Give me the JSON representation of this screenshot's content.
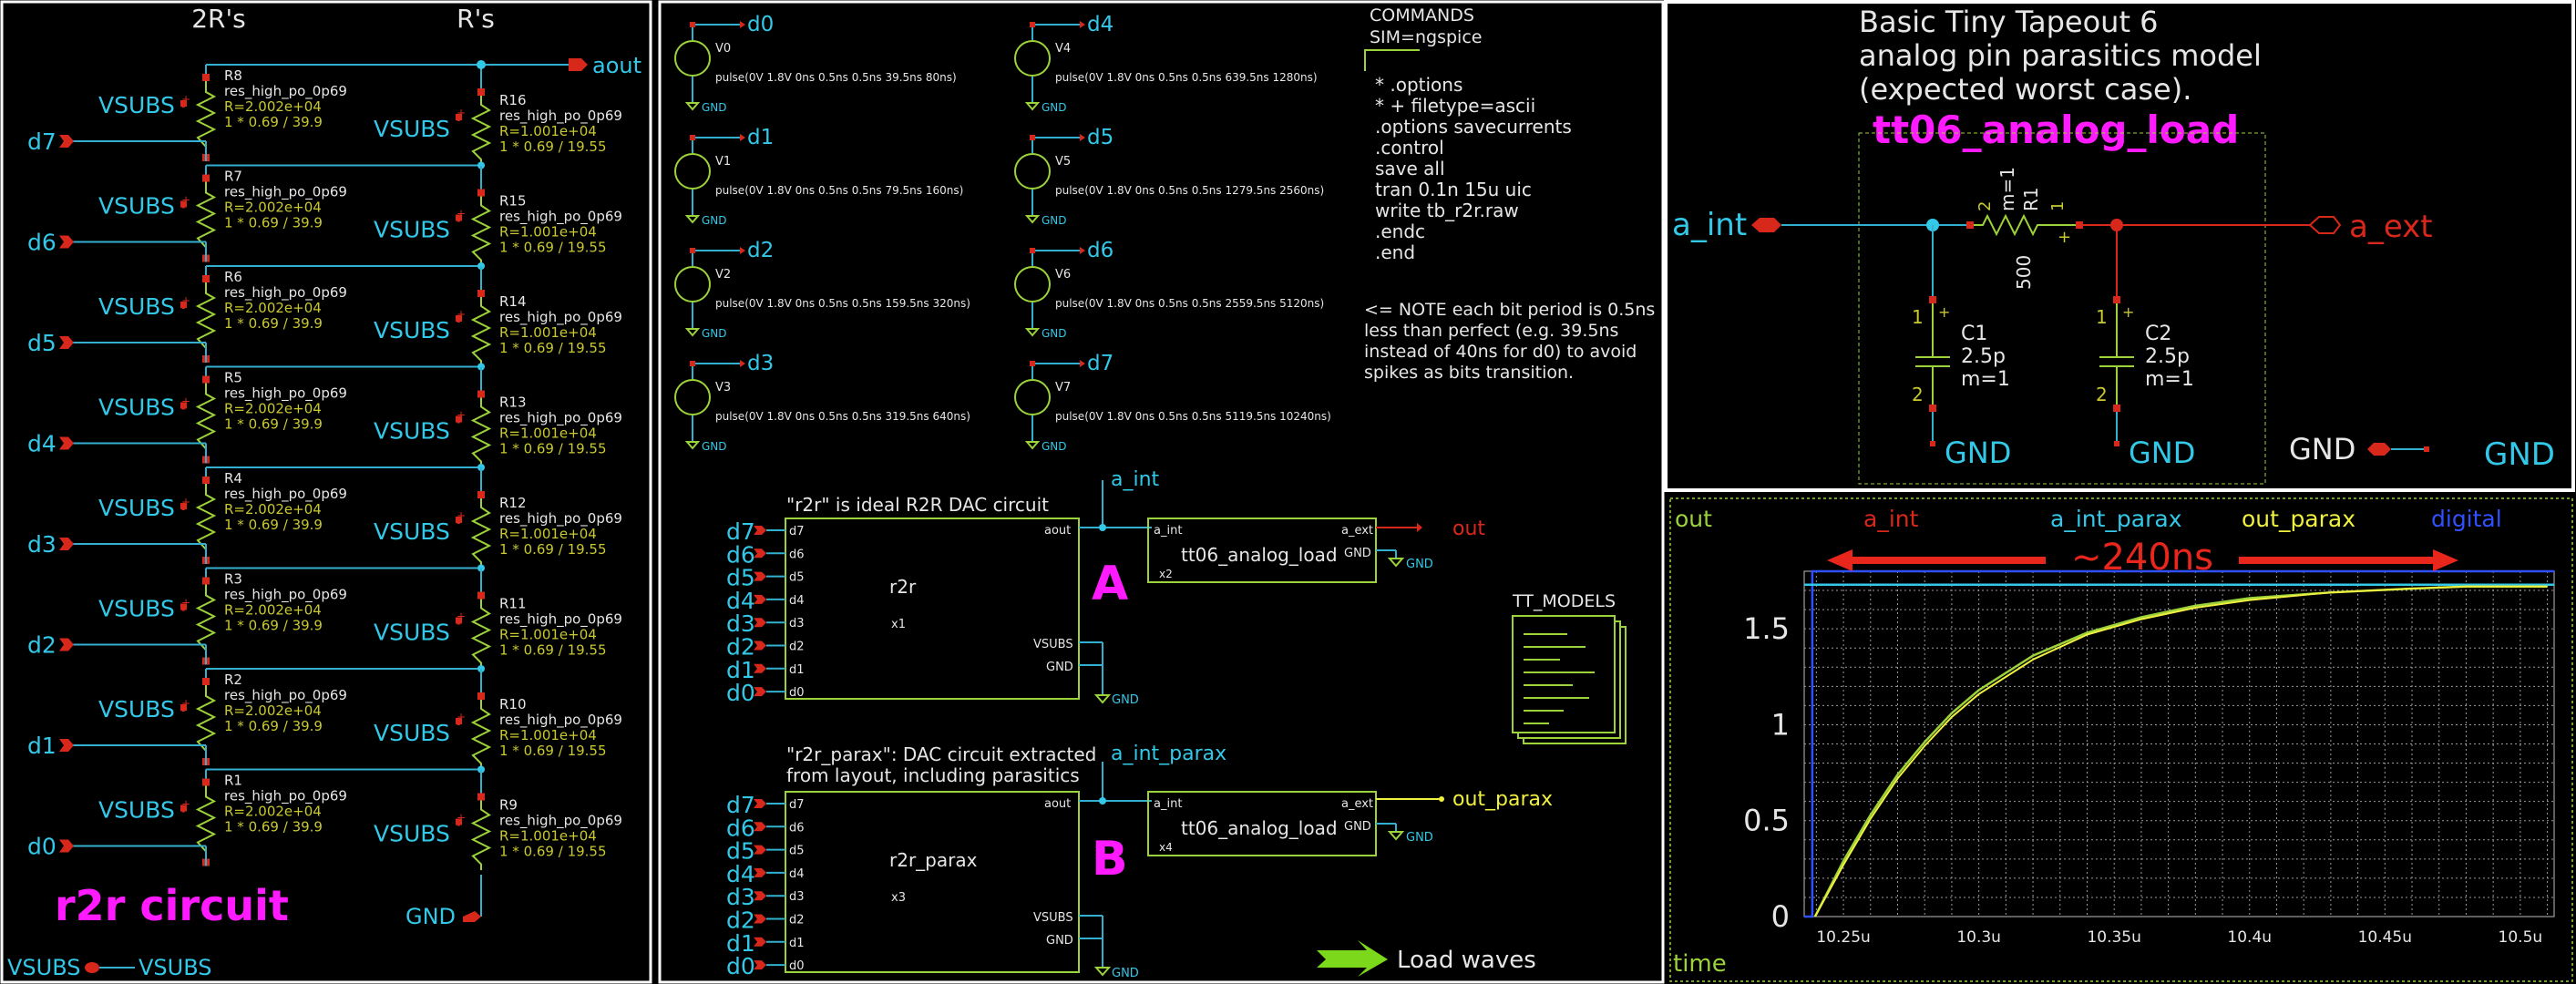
{
  "colors": {
    "background": "#000000",
    "wire": "#33b0d0",
    "label": "#33c8e8",
    "component": "#9cd23a",
    "pin": "#d8271b",
    "param": "#c8c830",
    "text": "#e6e6e6",
    "highlight": "#ff1aff",
    "panel_border": "#ffffff",
    "trace_yellow": "#f0f040",
    "trace_blue": "#3050ff",
    "trace_green": "#9cd23a"
  },
  "panel1": {
    "header_2r": "2R's",
    "header_r": "R's",
    "aout": "aout",
    "vsubs": "VSUBS",
    "gnd": "GND",
    "title": "r2r circuit",
    "footer_vsubs_a": "VSUBS",
    "footer_vsubs_b": "VSUBS",
    "pin_plus": "+",
    "pin_minus": "-",
    "rows": [
      {
        "digit": "d7",
        "r2": "R8",
        "r": "R16"
      },
      {
        "digit": "d6",
        "r2": "R7",
        "r": "R15"
      },
      {
        "digit": "d5",
        "r2": "R6",
        "r": "R14"
      },
      {
        "digit": "d4",
        "r2": "R5",
        "r": "R13"
      },
      {
        "digit": "d3",
        "r2": "R4",
        "r": "R12"
      },
      {
        "digit": "d2",
        "r2": "R3",
        "r": "R11"
      },
      {
        "digit": "d1",
        "r2": "R2",
        "r": "R10"
      },
      {
        "digit": "d0",
        "r2": "R1",
        "r": "R9"
      }
    ],
    "model": "res_high_po_0p69",
    "r2_value": "R=2.002e+04",
    "r2_mult": "1 * 0.69 / 39.9",
    "r_value": "R=1.001e+04",
    "r_mult": "1 * 0.69 / 19.55"
  },
  "panel2": {
    "sources": [
      {
        "name": "V0",
        "net": "d0",
        "pulse": "pulse(0V 1.8V 0ns 0.5ns 0.5ns 39.5ns 80ns)"
      },
      {
        "name": "V1",
        "net": "d1",
        "pulse": "pulse(0V 1.8V 0ns 0.5ns 0.5ns 79.5ns 160ns)"
      },
      {
        "name": "V2",
        "net": "d2",
        "pulse": "pulse(0V 1.8V 0ns 0.5ns 0.5ns 159.5ns 320ns)"
      },
      {
        "name": "V3",
        "net": "d3",
        "pulse": "pulse(0V 1.8V 0ns 0.5ns 0.5ns 319.5ns 640ns)"
      },
      {
        "name": "V4",
        "net": "d4",
        "pulse": "pulse(0V 1.8V 0ns 0.5ns 0.5ns 639.5ns 1280ns)"
      },
      {
        "name": "V5",
        "net": "d5",
        "pulse": "pulse(0V 1.8V 0ns 0.5ns 0.5ns 1279.5ns 2560ns)"
      },
      {
        "name": "V6",
        "net": "d6",
        "pulse": "pulse(0V 1.8V 0ns 0.5ns 0.5ns 2559.5ns 5120ns)"
      },
      {
        "name": "V7",
        "net": "d7",
        "pulse": "pulse(0V 1.8V 0ns 0.5ns 0.5ns 5119.5ns 10240ns)"
      }
    ],
    "gnd": "GND",
    "commands_title": "COMMANDS",
    "commands_sim": "SIM=ngspice",
    "commands": [
      " * .options",
      " * + filetype=ascii",
      " .options savecurrents",
      " .control",
      "   save all",
      "   tran 0.1n 15u uic",
      "   write tb_r2r.raw",
      " .endc",
      " .end"
    ],
    "note": [
      "<= NOTE each bit period is 0.5ns",
      "less than perfect (e.g. 39.5ns",
      "instead of 40ns for d0) to avoid",
      "spikes as bits transition."
    ],
    "pins_in": [
      "d7",
      "d6",
      "d5",
      "d4",
      "d3",
      "d2",
      "d1",
      "d0"
    ],
    "blockA": {
      "caption": "\"r2r\" is ideal R2R DAC circuit",
      "name": "r2r",
      "inst": "x1",
      "letter": "A",
      "net_int": "a_int",
      "out": "out",
      "load": "tt06_analog_load",
      "load_inst": "x2"
    },
    "blockB": {
      "caption1": "\"r2r_parax\": DAC circuit extracted",
      "caption2": "from layout, including parasitics",
      "name": "r2r_parax",
      "inst": "x3",
      "letter": "B",
      "net_int": "a_int_parax",
      "out": "out_parax",
      "load": "tt06_analog_load",
      "load_inst": "x4"
    },
    "pin_aout": "aout",
    "pin_vsubs": "VSUBS",
    "pin_gnd": "GND",
    "pin_aint": "a_int",
    "pin_aext": "a_ext",
    "tt_models": "TT_MODELS",
    "load_waves": "Load waves"
  },
  "panel3": {
    "title": [
      "Basic Tiny Tapeout 6",
      "analog pin parasitics model",
      "(expected worst case)."
    ],
    "subckt": "tt06_analog_load",
    "a_int": "a_int",
    "a_ext": "a_ext",
    "r1_name": "R1",
    "r1_m": "m=1",
    "r1_value": "500",
    "c1": [
      "C1",
      "2.5p",
      "m=1"
    ],
    "c2": [
      "C2",
      "2.5p",
      "m=1"
    ],
    "gnd": "GND",
    "pin1": "1",
    "pin2": "2",
    "plus": "+"
  },
  "panel4": {
    "legend": [
      {
        "label": "out",
        "color": "#9cd23a"
      },
      {
        "label": "a_int",
        "color": "#d8271b"
      },
      {
        "label": "a_int_parax",
        "color": "#33c8e8"
      },
      {
        "label": "out_parax",
        "color": "#f0f040"
      },
      {
        "label": "digital",
        "color": "#3050ff"
      }
    ],
    "annotation": "~240ns",
    "xaxis_label": "time"
  },
  "chart_data": {
    "type": "line",
    "xlabel": "time",
    "ylabel": "",
    "xticks": [
      "10.25u",
      "10.3u",
      "10.35u",
      "10.4u",
      "10.45u",
      "10.5u"
    ],
    "yticks": [
      "0",
      "0.5",
      "1",
      "1.5"
    ],
    "xlim": [
      10.2355,
      10.5125
    ],
    "ylim": [
      0,
      1.8
    ],
    "grid": true,
    "series": [
      {
        "name": "out",
        "x": [
          10.2395,
          10.25,
          10.26,
          10.27,
          10.28,
          10.29,
          10.3,
          10.32,
          10.34,
          10.36,
          10.38,
          10.4,
          10.43,
          10.46,
          10.48,
          10.5,
          10.51
        ],
        "y": [
          0,
          0.29,
          0.53,
          0.74,
          0.91,
          1.06,
          1.18,
          1.36,
          1.48,
          1.56,
          1.62,
          1.66,
          1.69,
          1.71,
          1.72,
          1.72,
          1.72
        ]
      },
      {
        "name": "out_parax",
        "x": [
          10.2395,
          10.25,
          10.26,
          10.27,
          10.28,
          10.29,
          10.3,
          10.32,
          10.34,
          10.36,
          10.38,
          10.4,
          10.43,
          10.46,
          10.48,
          10.5,
          10.51
        ],
        "y": [
          0,
          0.27,
          0.51,
          0.72,
          0.89,
          1.04,
          1.16,
          1.34,
          1.47,
          1.55,
          1.61,
          1.65,
          1.69,
          1.71,
          1.72,
          1.72,
          1.72
        ]
      },
      {
        "name": "a_int_parax",
        "x": [
          10.2355,
          10.2392,
          10.2397,
          10.26,
          10.3,
          10.4,
          10.5125
        ],
        "y": [
          1.73,
          1.73,
          1.73,
          1.73,
          1.73,
          1.73,
          1.73
        ]
      },
      {
        "name": "digital",
        "x": [
          10.2355,
          10.2385,
          10.2385,
          10.5125
        ],
        "y": [
          0,
          0,
          1.8,
          1.8
        ]
      }
    ]
  }
}
